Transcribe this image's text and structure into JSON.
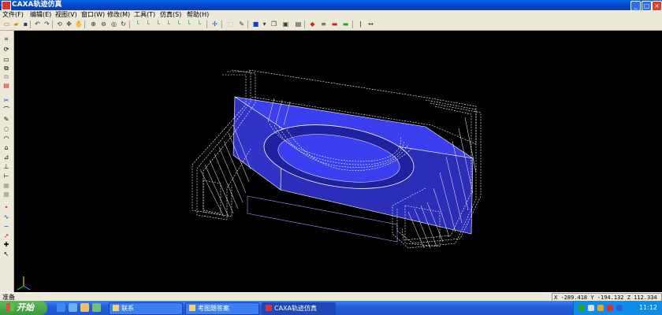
{
  "window": {
    "title": "CAXA轨迹仿真"
  },
  "menu": [
    "文件(F)",
    "编辑(E)",
    "视图(V)",
    "窗口(W)",
    "修改(M)",
    "工具(T)",
    "仿真(S)",
    "帮助(H)"
  ],
  "status": {
    "text": "准备",
    "coords": "X -289.418 Y -194.132 Z  112.334"
  },
  "taskbar": {
    "start": "开始",
    "tasks": [
      "联系",
      "考图题答案",
      "CAXA轨迹仿真"
    ],
    "clock": "11:12"
  },
  "colors": {
    "part": "#3b3ff0",
    "toolpath": "#ffffff"
  },
  "icons": {
    "toolbar": [
      "new-file-icon",
      "open-file-icon",
      "save-icon",
      "undo-icon",
      "redo-icon",
      "pan-icon",
      "hand-icon",
      "zoom-in-icon",
      "zoom-out-icon",
      "zoom-window-icon",
      "refresh-icon",
      "line-icon",
      "plane-icon",
      "axis-icon",
      "rotate-icon",
      "curve-icon",
      "snap-icon",
      "move-icon",
      "select-icon",
      "pencil-icon",
      "box-icon",
      "cube-icon",
      "copy-icon",
      "window-icon",
      "layer-icon",
      "color-icon",
      "measure-icon",
      "dimension-icon"
    ],
    "left": [
      "trim-icon",
      "rotate-icon",
      "rectangle-icon",
      "copy-icon",
      "paste-icon",
      "tag-icon",
      "scissors-icon",
      "arc-icon",
      "circle-icon",
      "pencil-icon",
      "line-icon",
      "ruler-icon",
      "tool-icon",
      "mirror-icon",
      "array-icon",
      "point-icon",
      "spline-icon",
      "offset-icon",
      "cursor-icon",
      "axes-icon"
    ]
  }
}
